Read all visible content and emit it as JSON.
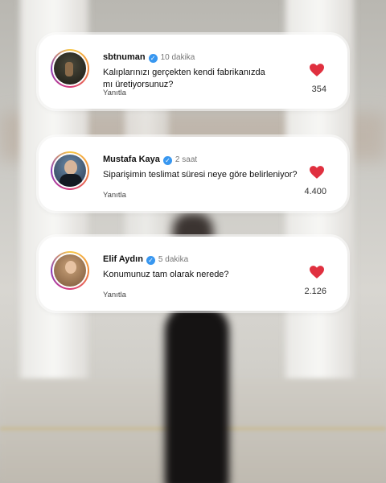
{
  "accent_colors": {
    "heart": "#e0303f",
    "verified": "#3897f0"
  },
  "comments": [
    {
      "username": "sbtnuman",
      "time": "10 dakika",
      "text": "Kalıplarınızı gerçekten kendi fabrikanızda mı üretiyorsunuz?",
      "reply_label": "Yanıtla",
      "likes": "354",
      "verified_icon": "✓"
    },
    {
      "username": "Mustafa Kaya",
      "time": "2 saat",
      "text": "Siparişimin teslimat süresi neye göre belirleniyor?",
      "reply_label": "Yanıtla",
      "likes": "4.400",
      "verified_icon": "✓"
    },
    {
      "username": "Elif Aydın",
      "time": "5 dakika",
      "text": "Konumunuz tam olarak nerede?",
      "reply_label": "Yanıtla",
      "likes": "2.126",
      "verified_icon": "✓"
    }
  ]
}
